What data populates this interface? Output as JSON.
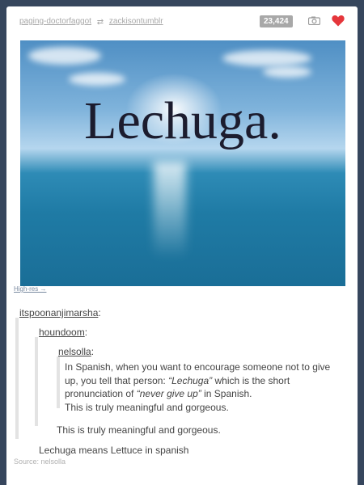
{
  "header": {
    "user_from": "paging-doctorfaggot",
    "user_to": "zackisontumblr",
    "notes": "23,424",
    "camera_icon": "camera-icon",
    "heart_icon": "heart-icon",
    "heart_color": "#e5363b"
  },
  "photo": {
    "title": "Lechuga.",
    "hires_link": "High-res →"
  },
  "thread": {
    "user1": "itspoonanjimarsha",
    "user2": "houndoom",
    "user3": "nelsolla",
    "quote_lines": [
      "In Spanish, when you want to encourage someone not to give",
      "up, you tell that person: “Lechuga” which is the short",
      "pronunciation of “never give up” in Spanish.",
      "This is truly meaningful and gorgeous."
    ],
    "quote_line2_prefix": "up, you tell that person: ",
    "quote_line2_italic": "“Lechuga”",
    "quote_line2_suffix": " which is the short",
    "quote_line3_prefix": "pronunciation of ",
    "quote_line3_italic": "“never give up”",
    "quote_line3_suffix": " in Spanish.",
    "reply2": "This is truly meaningful and gorgeous.",
    "reply1": "Lechuga means Lettuce in spanish"
  },
  "source": {
    "label": "Source: ",
    "name": "nelsolla"
  }
}
